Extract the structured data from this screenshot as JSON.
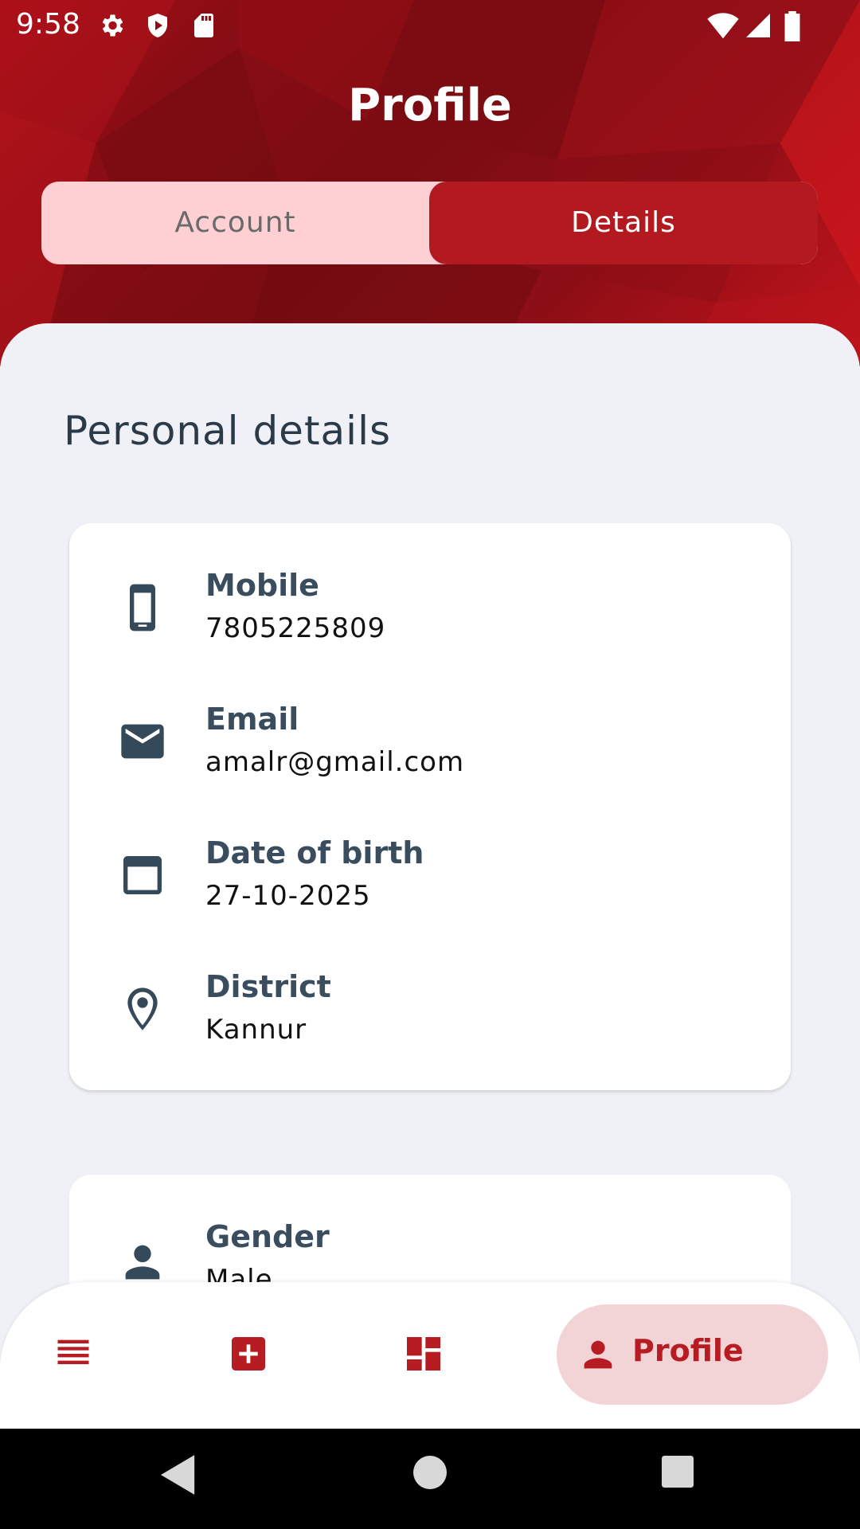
{
  "status_bar": {
    "time": "9:58",
    "icons": [
      "settings-icon",
      "shield-play-icon",
      "sd-card-icon",
      "wifi-icon",
      "signal-icon",
      "battery-icon"
    ]
  },
  "header": {
    "title": "Profile",
    "tabs": [
      {
        "label": "Account",
        "selected": false
      },
      {
        "label": "Details",
        "selected": true
      }
    ]
  },
  "section_title": "Personal details",
  "personal_details": [
    {
      "icon": "phone-icon",
      "label": "Mobile",
      "value": "7805225809"
    },
    {
      "icon": "email-icon",
      "label": "Email",
      "value": "amalr@gmail.com"
    },
    {
      "icon": "calendar-icon",
      "label": "Date of birth",
      "value": "27-10-2025"
    },
    {
      "icon": "location-pin-icon",
      "label": "District",
      "value": "Kannur"
    }
  ],
  "other_details": [
    {
      "icon": "person-icon",
      "label": "Gender",
      "value": "Male"
    }
  ],
  "bottom_nav": {
    "items": [
      {
        "icon": "list-icon",
        "label": ""
      },
      {
        "icon": "add-box-icon",
        "label": ""
      },
      {
        "icon": "dashboard-icon",
        "label": ""
      },
      {
        "icon": "person-icon",
        "label": "Profile",
        "selected": true
      }
    ]
  },
  "colors": {
    "header_red": "#8a0d14",
    "accent": "#b31a20",
    "tab_inactive_bg": "#ffd0d3",
    "nav_selected_bg": "#f2d4d7",
    "label_color": "#3a4d5e",
    "background": "#f0f1f6"
  }
}
